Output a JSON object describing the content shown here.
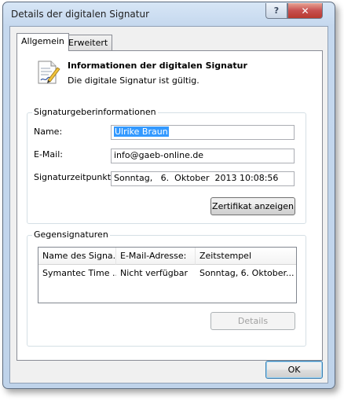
{
  "window": {
    "title": "Details der digitalen Signatur",
    "help_glyph": "?",
    "close_glyph": "✕"
  },
  "tabs": [
    {
      "label": "Allgemein",
      "active": true
    },
    {
      "label": "Erweitert",
      "active": false
    }
  ],
  "header": {
    "title": "Informationen der digitalen Signatur",
    "status": "Die digitale Signatur ist gültig.",
    "icon": "certificate-document-icon"
  },
  "signer_info": {
    "group_title": "Signaturgeberinformationen",
    "name_label": "Name:",
    "name_value": "Ulrike Braun",
    "email_label": "E-Mail:",
    "email_value": "info@gaeb-online.de",
    "time_label": "Signaturzeitpunkt:",
    "time_value": "Sonntag,   6.  Oktober  2013 10:08:56",
    "view_cert_button": "Zertifikat anzeigen"
  },
  "countersignatures": {
    "group_title": "Gegensignaturen",
    "columns": [
      "Name des Signa...",
      "E-Mail-Adresse:",
      "Zeitstempel"
    ],
    "rows": [
      [
        "Symantec Time ...",
        "Nicht verfügbar",
        "Sonntag, 6. Oktober..."
      ]
    ],
    "details_button": "Details"
  },
  "footer": {
    "ok_button": "OK"
  },
  "colors": {
    "selection": "#3399ff",
    "frame": "#c5d8ee",
    "close": "#c75050"
  }
}
